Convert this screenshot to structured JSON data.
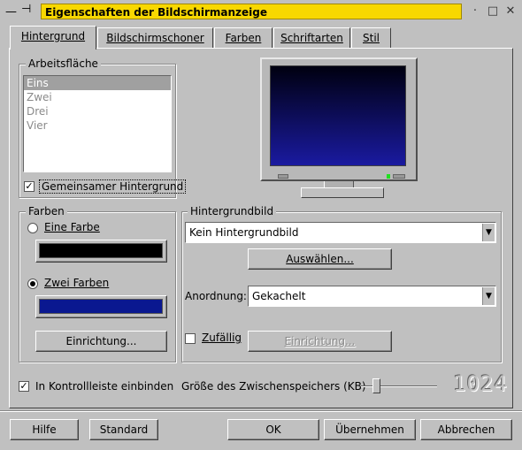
{
  "window": {
    "title": "Eigenschaften der Bildschirmanzeige",
    "controls": {
      "menu_icon": "menu-dash-icon",
      "pin_icon": "pin-icon",
      "minimize": "·",
      "maximize": "□",
      "close": "✕"
    }
  },
  "tabs": [
    {
      "label": "Hintergrund",
      "active": true
    },
    {
      "label": "Bildschirmschoner",
      "active": false
    },
    {
      "label": "Farben",
      "active": false
    },
    {
      "label": "Schriftarten",
      "active": false
    },
    {
      "label": "Stil",
      "active": false
    }
  ],
  "arbeitsflaeche": {
    "label": "Arbeitsfläche",
    "items": [
      "Eins",
      "Zwei",
      "Drei",
      "Vier"
    ],
    "selected": "Eins",
    "shared_bg_label": "Gemeinsamer Hintergrund",
    "shared_bg_checked": true
  },
  "preview": {
    "gradient_top": "#000010",
    "gradient_bottom": "#1a1aa0"
  },
  "farben": {
    "label": "Farben",
    "one_color_label": "Eine Farbe",
    "two_colors_label": "Zwei Farben",
    "selected_mode": "Zwei Farben",
    "color1": "#000000",
    "color2": "#0a1890",
    "setup_button": "Einrichtung..."
  },
  "hintergrundbild": {
    "label": "Hintergrundbild",
    "image_value": "Kein Hintergrundbild",
    "choose_button": "Auswählen...",
    "arrangement_label": "Anordnung:",
    "arrangement_value": "Gekachelt",
    "random_label": "Zufällig",
    "random_checked": false,
    "setup_button": "Einrichtung..."
  },
  "bottom_options": {
    "taskbar_label": "In Kontrollleiste einbinden",
    "taskbar_checked": true,
    "cache_label": "Größe des Zwischenspeichers (KB)",
    "cache_value": "1024",
    "cache_slider_fraction": 0.2
  },
  "buttons": {
    "help": "Hilfe",
    "default": "Standard",
    "ok": "OK",
    "apply": "Übernehmen",
    "cancel": "Abbrechen"
  }
}
